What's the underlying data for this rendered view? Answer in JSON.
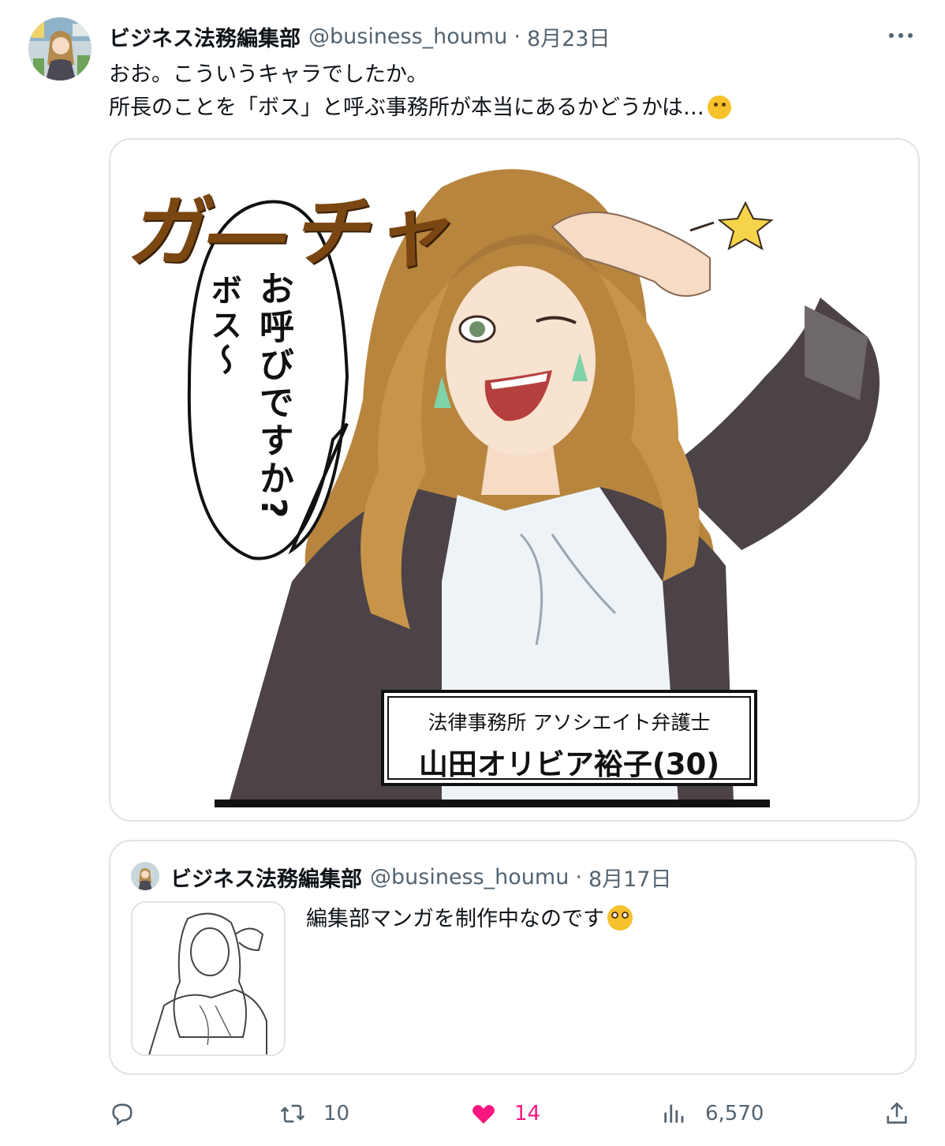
{
  "post": {
    "author_name": "ビジネス法務編集部",
    "author_handle": "@business_houmu",
    "separator": "·",
    "date": "8月23日",
    "text_line1": "おお。こういうキャラでしたか。",
    "text_line2": "所長のことを「ボス」と呼ぶ事務所が本当にあるかどうかは…",
    "text_line2_emoji": "thinking-face-emoji"
  },
  "media": {
    "sound_effect": "ガ―チャ",
    "speech_line1": "お呼びですか?",
    "speech_line2": "ボス〜",
    "role": "法律事務所 アソシエイト弁護士",
    "name": "山田オリビア裕子(30)"
  },
  "quote": {
    "author_name": "ビジネス法務編集部",
    "author_handle": "@business_houmu",
    "separator": "·",
    "date": "8月17日",
    "text": "編集部マンガを制作中なのです",
    "text_emoji": "flushed-face-emoji"
  },
  "actions": {
    "reply_icon": "reply-icon",
    "retweet_icon": "retweet-icon",
    "retweet_count": "10",
    "like_icon": "heart-icon",
    "like_count": "14",
    "views_icon": "views-icon",
    "views_count": "6,570",
    "share_icon": "share-icon"
  },
  "colors": {
    "text": "#0f1419",
    "secondary": "#536471",
    "border": "#dde3e8",
    "like": "#f91880",
    "sfx": "#7a4712"
  }
}
